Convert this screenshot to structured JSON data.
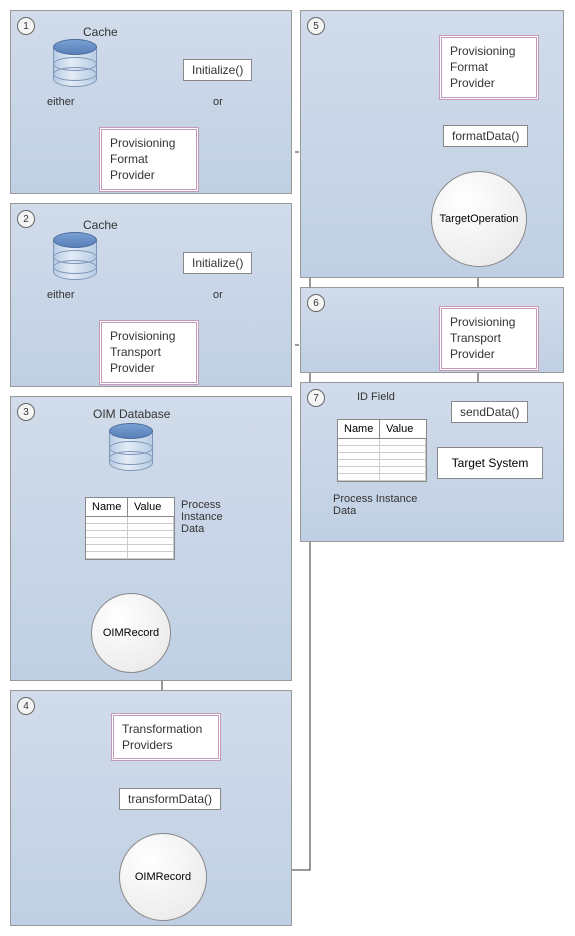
{
  "panels": {
    "p1": {
      "num": "1",
      "cache_label": "Cache",
      "either": "either",
      "or": "or",
      "init": "Initialize()",
      "provider_l1": "Provisioning",
      "provider_l2": "Format",
      "provider_l3": "Provider"
    },
    "p2": {
      "num": "2",
      "cache_label": "Cache",
      "either": "either",
      "or": "or",
      "init": "Initialize()",
      "provider_l1": "Provisioning",
      "provider_l2": "Transport",
      "provider_l3": "Provider"
    },
    "p3": {
      "num": "3",
      "db_label": "OIM Database",
      "tbl_name": "Name",
      "tbl_value": "Value",
      "pid_l1": "Process",
      "pid_l2": "Instance",
      "pid_l3": "Data",
      "record": "OIMRecord"
    },
    "p4": {
      "num": "4",
      "provider_l1": "Transformation",
      "provider_l2": "Providers",
      "method": "transformData()",
      "record": "OIMRecord"
    },
    "p5": {
      "num": "5",
      "provider_l1": "Provisioning",
      "provider_l2": "Format",
      "provider_l3": "Provider",
      "method": "formatData()",
      "target_op": "TargetOperation"
    },
    "p6": {
      "num": "6",
      "provider_l1": "Provisioning",
      "provider_l2": "Transport",
      "provider_l3": "Provider"
    },
    "p7": {
      "num": "7",
      "id_field": "ID Field",
      "tbl_name": "Name",
      "tbl_value": "Value",
      "pid_l1": "Process Instance",
      "pid_l2": "Data",
      "send": "sendData()",
      "target": "Target System"
    }
  }
}
